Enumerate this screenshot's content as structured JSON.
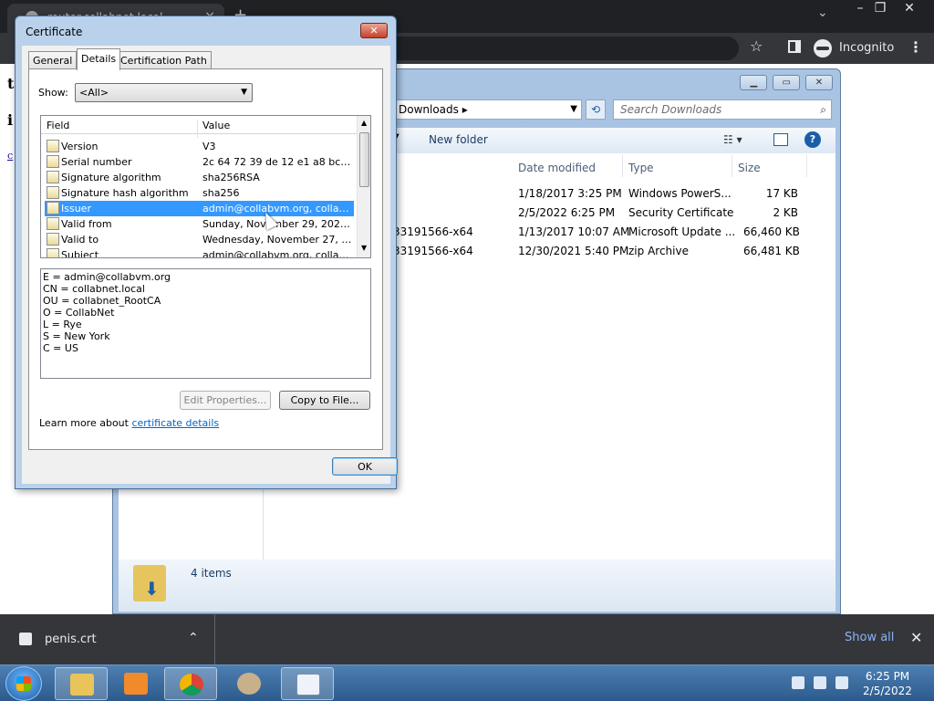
{
  "browser": {
    "tab_title": "router.collabnet.local",
    "tab_close": "×",
    "new_tab": "+",
    "tab_search": "⌄",
    "minimize": "–",
    "maximize": "❐",
    "close": "✕",
    "bookmark_icon": "☆",
    "incognito_label": "Incognito",
    "menu_icon": "⋮"
  },
  "page": {
    "fragment_1": "t",
    "fragment_2": "i",
    "fragment_3": "c"
  },
  "explorer": {
    "address": "Downloads ▸",
    "search_placeholder": "Search Downloads",
    "new_folder": "New folder",
    "view_options": "☷ ▾",
    "help": "?",
    "columns": {
      "date": "Date modified",
      "type": "Type",
      "size": "Size"
    },
    "files": [
      {
        "name": "",
        "date": "1/18/2017 3:25 PM",
        "type": "Windows PowerS...",
        "size": "17 KB"
      },
      {
        "name": "",
        "date": "2/5/2022 6:25 PM",
        "type": "Security Certificate",
        "size": "2 KB"
      },
      {
        "name": "33191566-x64",
        "date": "1/13/2017 10:07 AM",
        "type": "Microsoft Update ...",
        "size": "66,460 KB"
      },
      {
        "name": "33191566-x64",
        "date": "12/30/2021 5:40 PM",
        "type": "zip Archive",
        "size": "66,481 KB"
      }
    ],
    "item_count": "4 items"
  },
  "certificate": {
    "title": "Certificate",
    "close": "✕",
    "tabs": [
      "General",
      "Details",
      "Certification Path"
    ],
    "show_label": "Show:",
    "show_value": "<All>",
    "header_field": "Field",
    "header_value": "Value",
    "fields": [
      {
        "name": "Version",
        "value": "V3"
      },
      {
        "name": "Serial number",
        "value": "2c 64 72 39 de 12 e1 a8 bc 22..."
      },
      {
        "name": "Signature algorithm",
        "value": "sha256RSA"
      },
      {
        "name": "Signature hash algorithm",
        "value": "sha256"
      },
      {
        "name": "Issuer",
        "value": "admin@collabvm.org, collabne..."
      },
      {
        "name": "Valid from",
        "value": "Sunday, November 29, 2020 1..."
      },
      {
        "name": "Valid to",
        "value": "Wednesday, November 27, 20..."
      },
      {
        "name": "Subject",
        "value": "admin@collabvm.org, collabne..."
      }
    ],
    "issuer_details": [
      "E = admin@collabvm.org",
      "CN = collabnet.local",
      "OU = collabnet_RootCA",
      "O = CollabNet",
      "L = Rye",
      "S = New York",
      "C = US"
    ],
    "edit_properties": "Edit Properties...",
    "copy_to_file": "Copy to File...",
    "learn_more_prefix": "Learn more about ",
    "learn_more_link": "certificate details",
    "ok": "OK"
  },
  "downloads": {
    "filename": "penis.crt",
    "chevron": "⌃",
    "show_all": "Show all",
    "close": "✕"
  },
  "taskbar": {
    "time": "6:25 PM",
    "date": "2/5/2022"
  },
  "colors": {
    "selection": "#3399ff",
    "link": "#0066cc",
    "chrome_dark": "#202124"
  }
}
